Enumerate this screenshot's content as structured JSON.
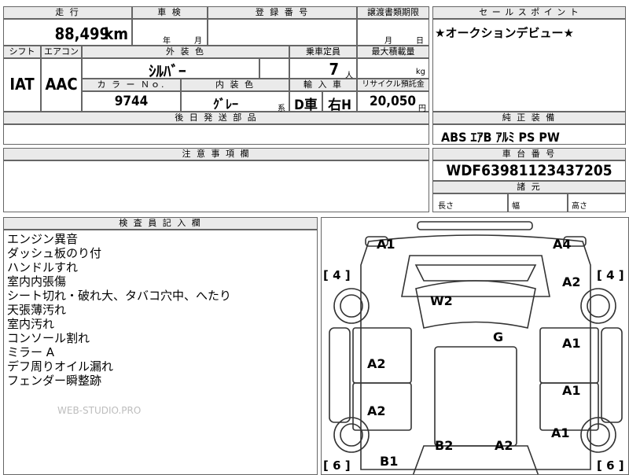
{
  "top": {
    "mileage_label": "走 行",
    "mileage_value": "88,499",
    "mileage_unit": "km",
    "inspection_label": "車 検",
    "year_suffix": "年",
    "month_suffix": "月",
    "registration_label": "登 録 番 号",
    "transfer_label": "譲渡書類期限",
    "transfer_month": "月",
    "transfer_day": "日"
  },
  "specs": {
    "shift_label": "シフト",
    "shift_value": "IAT",
    "aircon_label": "エアコン",
    "aircon_value": "AAC",
    "exterior_label": "外 装 色",
    "exterior_value": "ｼﾙﾊﾞｰ",
    "capacity_label": "乗車定員",
    "capacity_value": "7",
    "capacity_unit": "人",
    "maxload_label": "最大積載量",
    "maxload_unit": "kg",
    "colorno_label": "カ ラ ー Ｎｏ.",
    "colorno_value": "9744",
    "interior_label": "内 装 色",
    "interior_value": "ｸﾞﾚｰ",
    "interior_suffix": "系",
    "import_label": "輸 入 車",
    "import_value1": "D車",
    "import_value2": "右H",
    "recycle_label": "リサイクル預託金",
    "recycle_value": "20,050",
    "recycle_unit": "円",
    "later_parts_label": "後 日 発 送 部 品"
  },
  "sales": {
    "label": "セ ー ル ス ポ イ ン ト",
    "text": "★オークションデビュー★"
  },
  "equipment": {
    "label": "純 正 装 備",
    "text": "ABS ｴｱB ｱﾙﾐ PS PW"
  },
  "notes": {
    "label": "注 意 事 項 欄"
  },
  "chassis": {
    "label": "車 台 番 号",
    "value": "WDF63981123437205",
    "dims_label": "諸 元",
    "length_label": "長さ",
    "width_label": "幅",
    "height_label": "高さ"
  },
  "inspector": {
    "label": "検 査 員 記 入 欄",
    "lines": [
      "エンジン異音",
      "ダッシュ板のり付",
      "ハンドルすれ",
      "室内内張傷",
      "シート切れ・破れ大、タバコ穴中、へたり",
      "天張薄汚れ",
      "室内汚れ",
      "コンソール割れ",
      "ミラー A",
      "デフ周りオイル漏れ",
      "フェンダー瞬整跡"
    ],
    "watermark": "WEB-STUDIO.PRO"
  },
  "diagram": {
    "marks": [
      "A1",
      "A4",
      "A2",
      "W2",
      "G",
      "A2",
      "A1",
      "A2",
      "A1",
      "A1",
      "B2",
      "A2",
      "B1"
    ],
    "brackets": [
      "[ 4 ]",
      "[ 4 ]",
      "[ 6 ]",
      "[ 6 ]"
    ]
  }
}
